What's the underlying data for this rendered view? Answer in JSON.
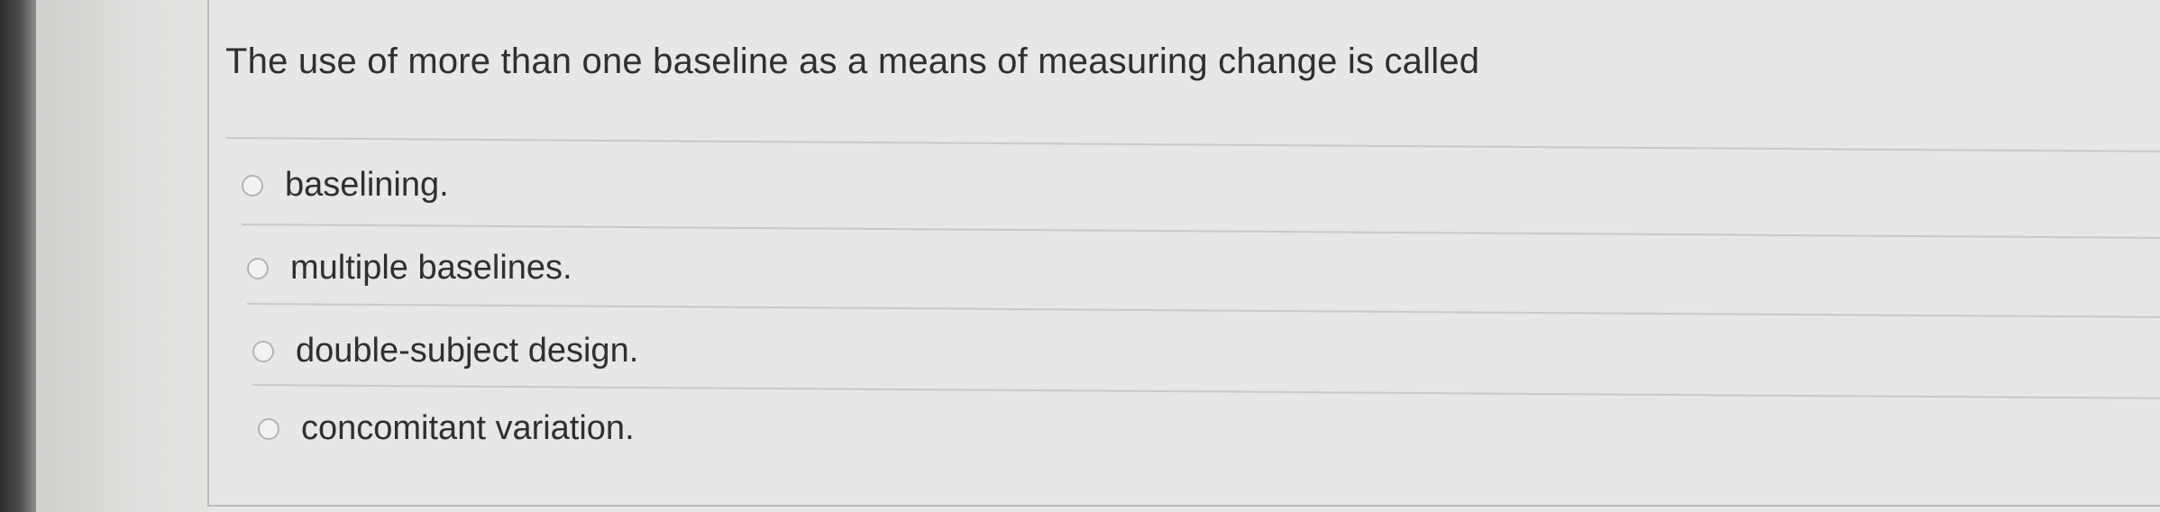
{
  "question": {
    "text": "The use of more than one baseline as a means of measuring change is called"
  },
  "options": [
    {
      "label": "baselining.",
      "selected": false
    },
    {
      "label": "multiple baselines.",
      "selected": false
    },
    {
      "label": "double-subject design.",
      "selected": false
    },
    {
      "label": "concomitant variation.",
      "selected": false
    }
  ]
}
